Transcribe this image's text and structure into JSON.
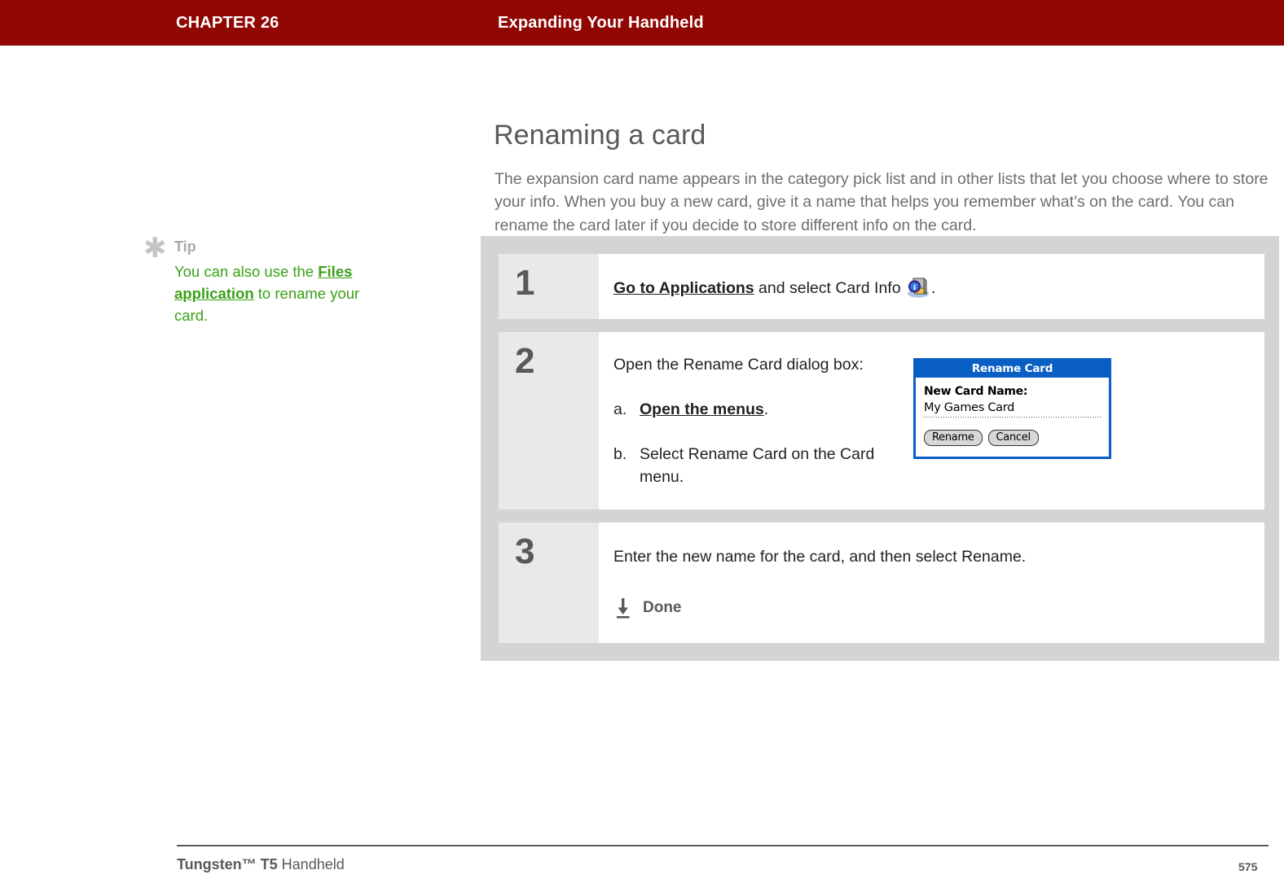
{
  "header": {
    "chapter": "CHAPTER 26",
    "title": "Expanding Your Handheld",
    "bar_color": "#900603"
  },
  "page": {
    "title": "Renaming a card",
    "intro": "The expansion card name appears in the category pick list and in other lists that let you choose where to store your info. When you buy a new card, give it a name that helps you remember what’s on the card. You can rename the card later if you decide to store different info on the card.",
    "title_color": "#58595b",
    "body_color": "#6d6e71"
  },
  "tip": {
    "icon": "asterisk-icon",
    "label": "Tip",
    "text_before_link": "You can also use the ",
    "link_text": "Files application",
    "text_after_link": " to rename your card.",
    "accent_color": "#3aa017",
    "label_color": "#a7a9ac"
  },
  "steps": {
    "panel_bg": "#d4d4d4",
    "number_cell_bg": "#e9e9e9",
    "items": [
      {
        "number": "1",
        "link_text": "Go to Applications",
        "text_after_link": " and select Card Info ",
        "icon": "card-info-icon",
        "trailing": "."
      },
      {
        "number": "2",
        "intro": "Open the Rename Card dialog box:",
        "substeps": [
          {
            "marker": "a.",
            "link_text": "Open the menus",
            "trailing": "."
          },
          {
            "marker": "b.",
            "text": "Select Rename Card on the Card menu."
          }
        ],
        "dialog": {
          "title": "Rename Card",
          "field_label": "New Card Name:",
          "field_value": "My Games Card",
          "primary_button": "Rename",
          "secondary_button": "Cancel",
          "accent_color": "#0a5fc4"
        }
      },
      {
        "number": "3",
        "text": "Enter the new name for the card, and then select Rename.",
        "done_icon": "down-arrow-icon",
        "done_label": "Done"
      }
    ]
  },
  "footer": {
    "product_bold": "Tungsten™ T5",
    "product_rest": " Handheld",
    "page_number": "575"
  }
}
